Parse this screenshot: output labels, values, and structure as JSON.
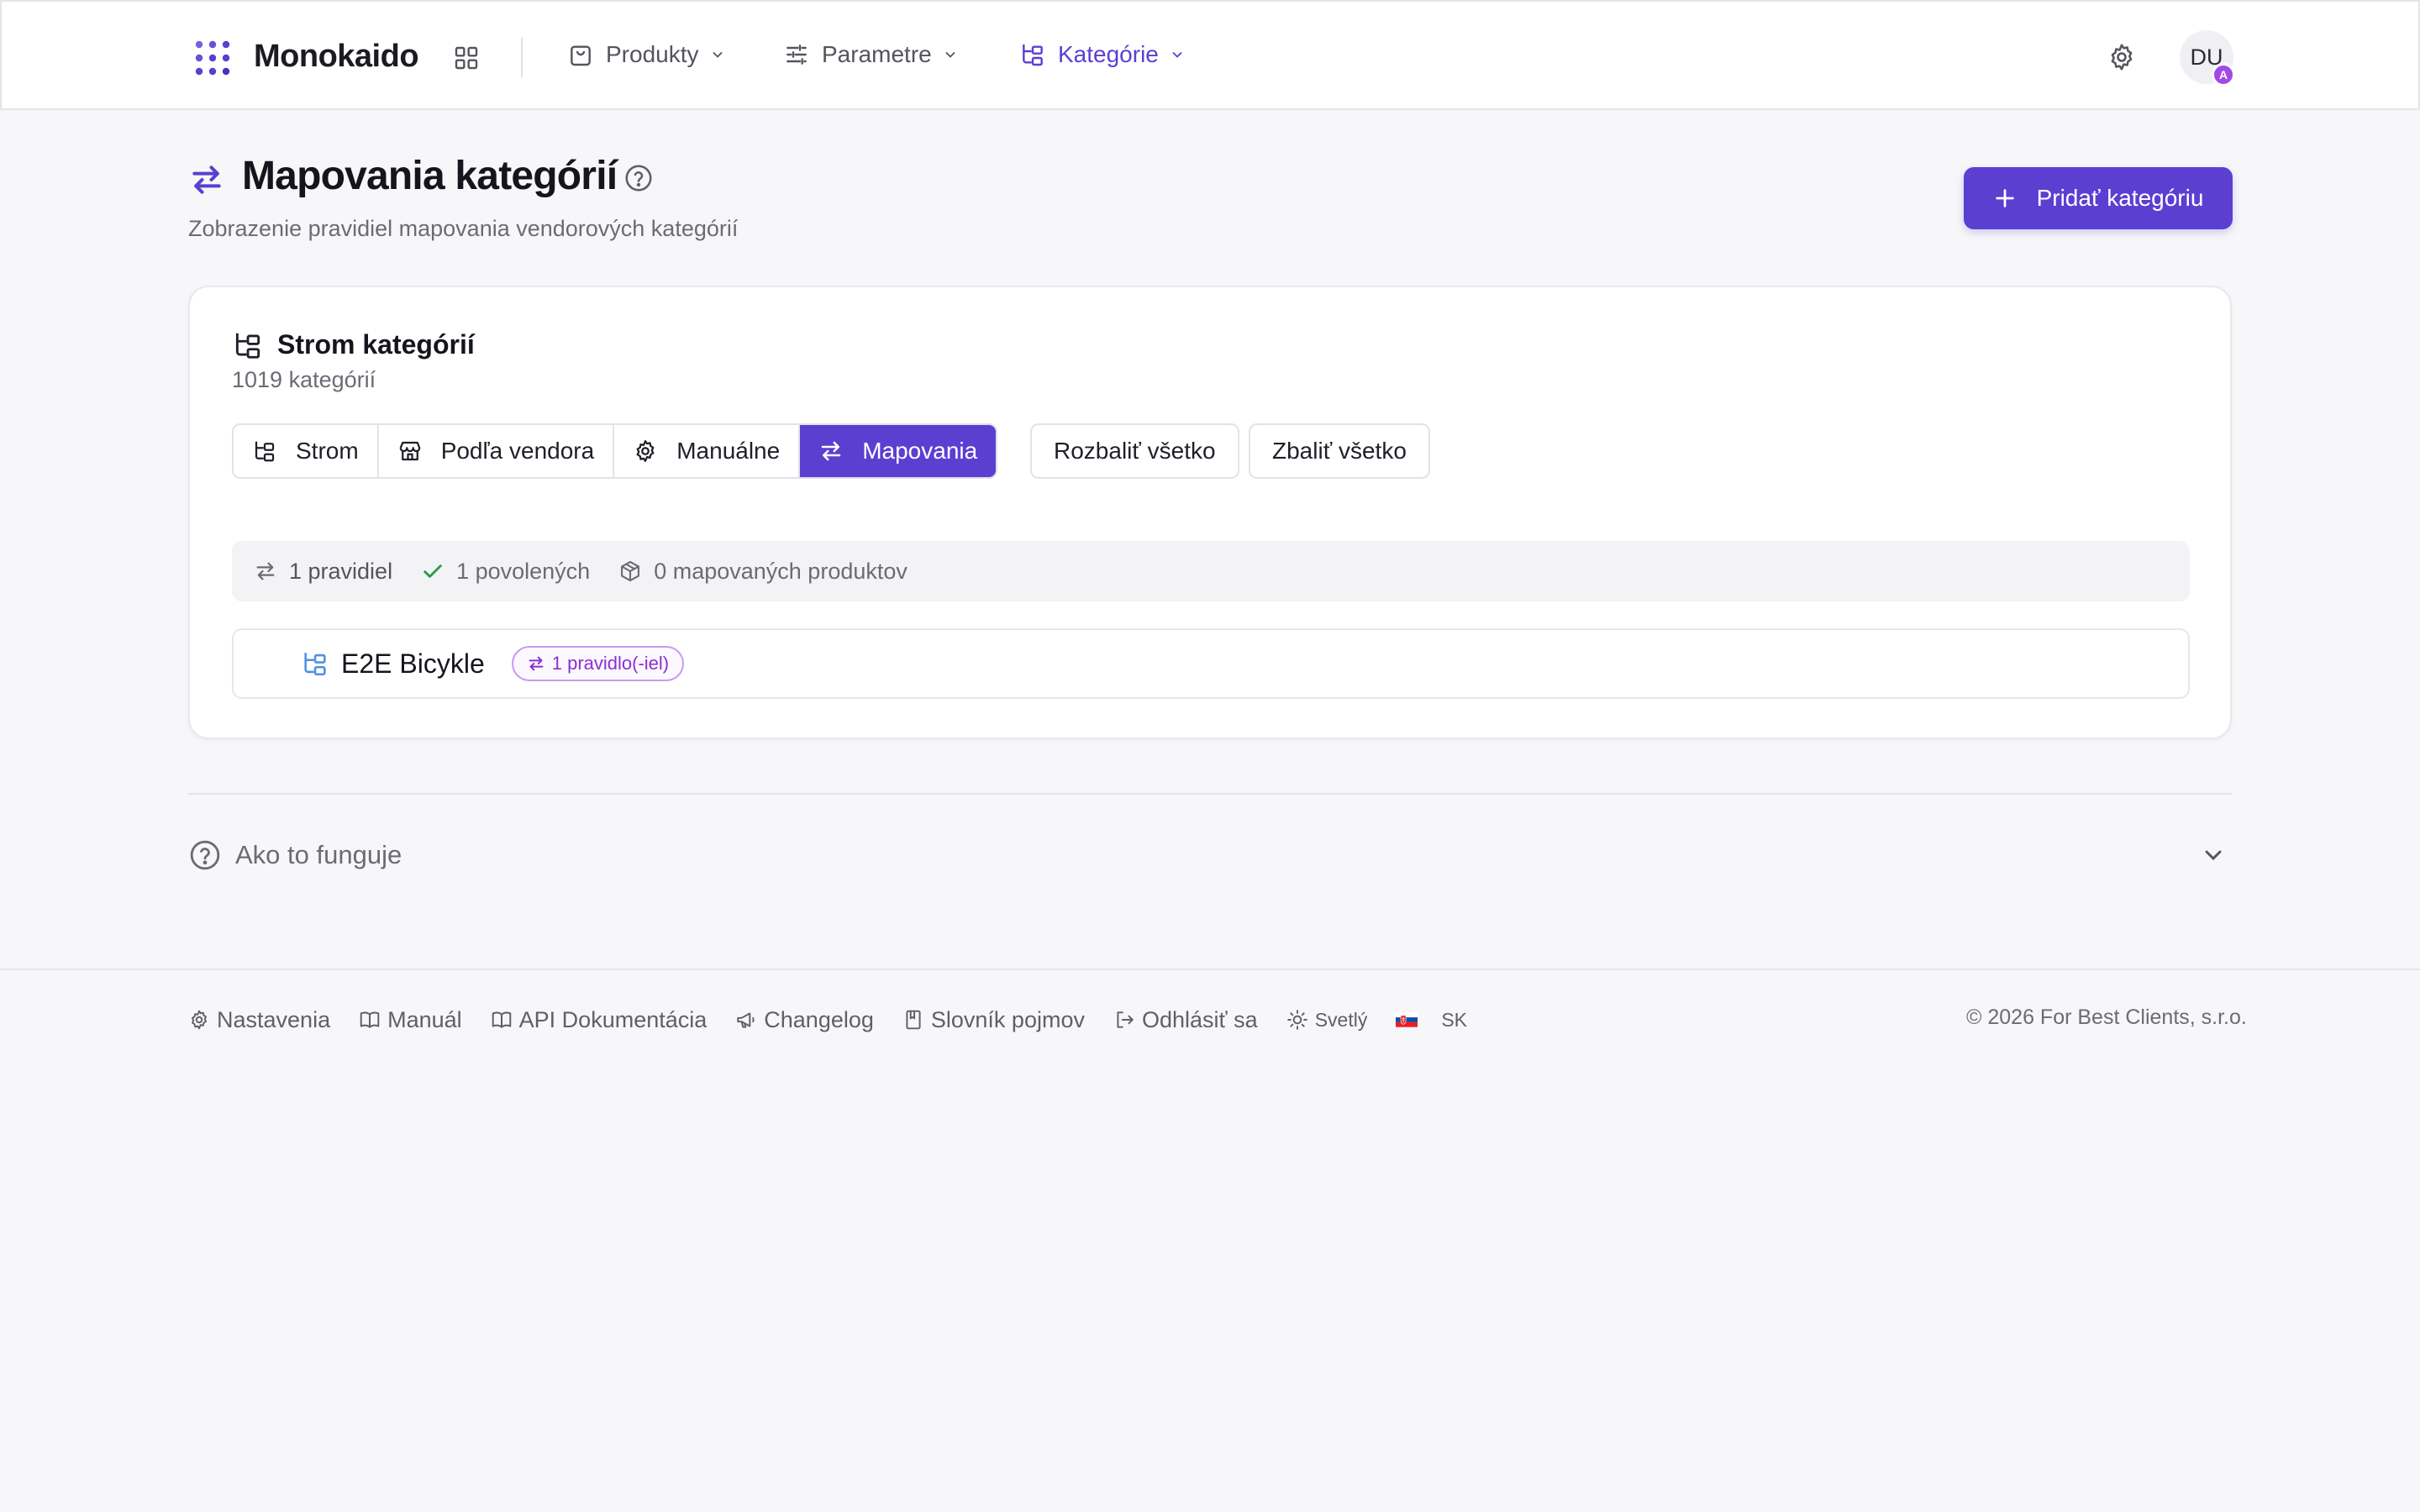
{
  "app": {
    "name": "Monokaido"
  },
  "nav": {
    "items": [
      {
        "label": "Produkty",
        "icon": "shopping-bag-icon"
      },
      {
        "label": "Parametre",
        "icon": "sliders-icon"
      },
      {
        "label": "Kategórie",
        "icon": "folder-tree-icon",
        "active": true
      }
    ],
    "user_initials": "DU",
    "user_badge": "A"
  },
  "header": {
    "title": "Mapovania kategórií",
    "subtitle": "Zobrazenie pravidiel mapovania vendorových kategórií",
    "add_button": "Pridať kategóriu"
  },
  "card": {
    "title": "Strom kategórií",
    "count": "1019 kategórií",
    "view_tabs": [
      {
        "label": "Strom",
        "icon": "tree-icon"
      },
      {
        "label": "Podľa vendora",
        "icon": "store-icon"
      },
      {
        "label": "Manuálne",
        "icon": "gear-icon"
      },
      {
        "label": "Mapovania",
        "icon": "arrows-swap-icon",
        "active": true
      }
    ],
    "expand_all": "Rozbaliť všetko",
    "collapse_all": "Zbaliť všetko",
    "stats": {
      "rules": "1 pravidiel",
      "allowed": "1 povolených",
      "mapped_products": "0 mapovaných produktov"
    },
    "rows": [
      {
        "name": "E2E Bicykle",
        "badge": "1 pravidlo(-iel)"
      }
    ]
  },
  "how_it_works": {
    "label": "Ako to funguje"
  },
  "footer": {
    "links": [
      {
        "label": "Nastavenia",
        "icon": "gear-icon"
      },
      {
        "label": "Manuál",
        "icon": "book-icon"
      },
      {
        "label": "API Dokumentácia",
        "icon": "book-icon"
      },
      {
        "label": "Changelog",
        "icon": "megaphone-icon"
      },
      {
        "label": "Slovník pojmov",
        "icon": "bookmark-icon"
      },
      {
        "label": "Odhlásiť sa",
        "icon": "logout-icon"
      }
    ],
    "theme": "Svetlý",
    "language": "SK",
    "copyright": "© 2026 For Best Clients, s.r.o."
  },
  "colors": {
    "accent": "#5b3fd1",
    "badge_purple": "#8a2fd0",
    "success_green": "#2a9a4a",
    "tree_icon_blue": "#4f8fe0"
  }
}
